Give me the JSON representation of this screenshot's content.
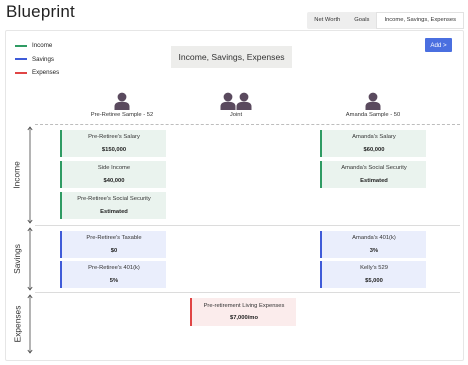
{
  "app": {
    "title": "Blueprint"
  },
  "tabs": [
    {
      "label": "Net Worth",
      "active": false
    },
    {
      "label": "Goals",
      "active": false
    },
    {
      "label": "Income, Savings, Expenses",
      "active": true
    }
  ],
  "legend": [
    {
      "label": "Income",
      "color": "#2f9b63"
    },
    {
      "label": "Savings",
      "color": "#3f5bd8"
    },
    {
      "label": "Expenses",
      "color": "#e04545"
    }
  ],
  "chart_title": "Income, Savings, Expenses",
  "add_button_label": "Add >",
  "columns": [
    {
      "label": "Pre-Retiree Sample - 52",
      "icon": "person-icon"
    },
    {
      "label": "Joint",
      "icon": "people-icon"
    },
    {
      "label": "Amanda Sample - 50",
      "icon": "person-icon"
    }
  ],
  "rows": {
    "income": {
      "label": "Income"
    },
    "savings": {
      "label": "Savings"
    },
    "expenses": {
      "label": "Expenses"
    }
  },
  "cards": {
    "income_left": [
      {
        "title": "Pre-Retiree's Salary",
        "value": "$150,000"
      },
      {
        "title": "Side Income",
        "value": "$40,000"
      },
      {
        "title": "Pre-Retiree's Social Security",
        "value": "Estimated"
      }
    ],
    "income_right": [
      {
        "title": "Amanda's Salary",
        "value": "$60,000"
      },
      {
        "title": "Amanda's Social Security",
        "value": "Estimated"
      }
    ],
    "savings_left": [
      {
        "title": "Pre-Retiree's Taxable",
        "value": "$0"
      },
      {
        "title": "Pre-Retiree's 401(k)",
        "value": "5%"
      }
    ],
    "savings_right": [
      {
        "title": "Amanda's 401(k)",
        "value": "3%"
      },
      {
        "title": "Kelly's 529",
        "value": "$5,000"
      }
    ],
    "expenses_joint": [
      {
        "title": "Pre-retirement Living Expenses",
        "value": "$7,000/mo"
      }
    ]
  },
  "colors": {
    "income": "#2f9b63",
    "savings": "#3f5bd8",
    "expenses": "#e04545",
    "accent": "#4a6fe0",
    "person": "#5a4a5e"
  }
}
